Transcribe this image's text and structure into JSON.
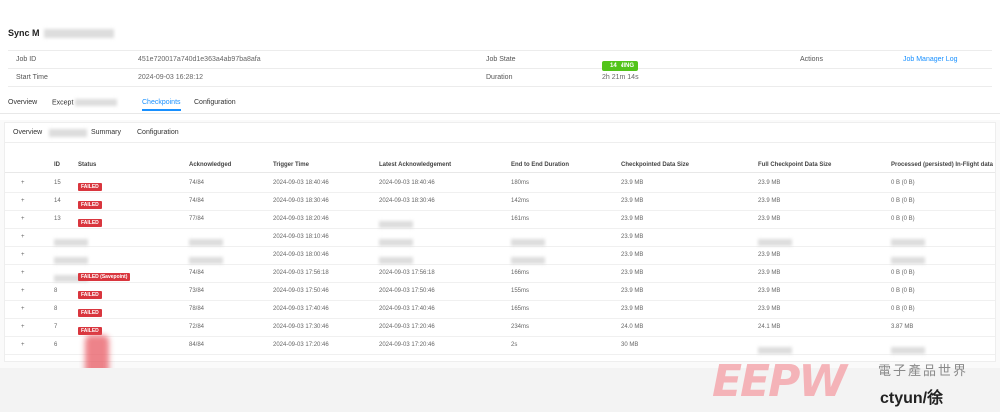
{
  "job": {
    "title": "Sync M",
    "labels": {
      "job_id": "Job ID",
      "start_time": "Start Time",
      "job_state": "Job State",
      "duration": "Duration",
      "actions": "Actions"
    },
    "job_id": "451e720017a740d1e363a4ab97ba8afa",
    "start_time": "2024-09-03 16:28:12",
    "state": "RUNNING",
    "state_count": "14",
    "duration": "2h 21m 14s",
    "action_link": "Job Manager Log"
  },
  "main_tabs": [
    "Overview",
    "Except",
    "Checkpoints",
    "Configuration"
  ],
  "sub_tabs": [
    "Overview",
    "Summary",
    "Configuration"
  ],
  "table": {
    "headers": [
      "ID",
      "Status",
      "Acknowledged",
      "Trigger Time",
      "Latest Acknowledgement",
      "End to End Duration",
      "Checkpointed Data Size",
      "Full Checkpoint Data Size",
      "Processed (persisted) In-Flight data"
    ],
    "rows": [
      {
        "expand": "+",
        "id": "15",
        "status": "FAILED",
        "ack": "74/84",
        "trigger": "2024-09-03 18:40:46",
        "latest": "2024-09-03 18:40:46",
        "dur": "180ms",
        "size": "23.9 MB",
        "full": "23.9 MB",
        "proc": "0 B (0 B)"
      },
      {
        "expand": "+",
        "id": "14",
        "status": "FAILED",
        "ack": "74/84",
        "trigger": "2024-09-03 18:30:46",
        "latest": "2024-09-03 18:30:46",
        "dur": "142ms",
        "size": "23.9 MB",
        "full": "23.9 MB",
        "proc": "0 B (0 B)"
      },
      {
        "expand": "+",
        "id": "13",
        "status": "FAILED",
        "ack": "77/84",
        "trigger": "2024-09-03 18:20:46",
        "latest": "",
        "dur": "161ms",
        "size": "23.9 MB",
        "full": "23.9 MB",
        "proc": "0 B (0 B)"
      },
      {
        "expand": "+",
        "id": "",
        "status": "",
        "ack": "",
        "trigger": "2024-09-03 18:10:46",
        "latest": "",
        "dur": "",
        "size": "23.9 MB",
        "full": "",
        "proc": ""
      },
      {
        "expand": "+",
        "id": "",
        "status": "",
        "ack": "",
        "trigger": "2024-09-03 18:00:46",
        "latest": "",
        "dur": "",
        "size": "23.9 MB",
        "full": "23.9 MB",
        "proc": ""
      },
      {
        "expand": "+",
        "id": "",
        "status": "FAILED (Savepoint)",
        "ack": "74/84",
        "trigger": "2024-09-03 17:56:18",
        "latest": "2024-09-03 17:56:18",
        "dur": "166ms",
        "size": "23.9 MB",
        "full": "23.9 MB",
        "proc": "0 B (0 B)"
      },
      {
        "expand": "+",
        "id": "8",
        "status": "FAILED",
        "ack": "73/84",
        "trigger": "2024-09-03 17:50:46",
        "latest": "2024-09-03 17:50:46",
        "dur": "155ms",
        "size": "23.9 MB",
        "full": "23.9 MB",
        "proc": "0 B (0 B)"
      },
      {
        "expand": "+",
        "id": "8",
        "status": "FAILED",
        "ack": "78/84",
        "trigger": "2024-09-03 17:40:46",
        "latest": "2024-09-03 17:40:46",
        "dur": "165ms",
        "size": "23.9 MB",
        "full": "23.9 MB",
        "proc": "0 B (0 B)"
      },
      {
        "expand": "+",
        "id": "7",
        "status": "FAILED",
        "ack": "72/84",
        "trigger": "2024-09-03 17:30:46",
        "latest": "2024-09-03 17:20:46",
        "dur": "234ms",
        "size": "24.0 MB",
        "full": "24.1 MB",
        "proc": "3.87 MB"
      },
      {
        "expand": "+",
        "id": "6",
        "status": "",
        "ack": "84/84",
        "trigger": "2024-09-03 17:20:46",
        "latest": "2024-09-03 17:20:46",
        "dur": "2s",
        "size": "30 MB",
        "full": "",
        "proc": ""
      }
    ]
  },
  "watermark": {
    "logo": "EEPW",
    "cn": "電子產品世界",
    "user": "ctyun/徐"
  },
  "colors": {
    "accent": "#1890ff",
    "running": "#52c41a",
    "failed": "#d9363e"
  }
}
